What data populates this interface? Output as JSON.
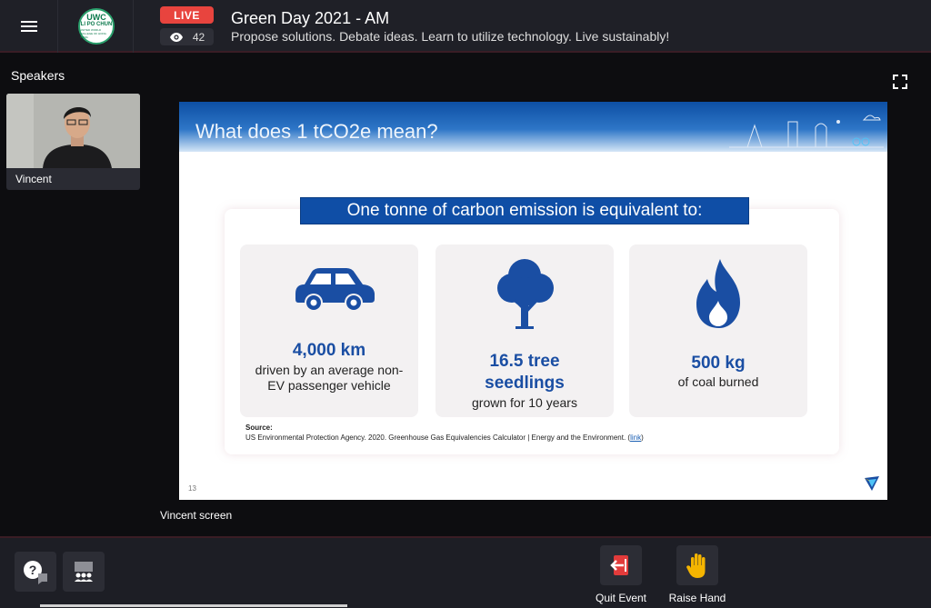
{
  "header": {
    "menu_icon": "hamburger-menu-icon",
    "logo": {
      "line1": "UWC",
      "line2": "LI PO CHUN",
      "line3": "UNITED WORLD COLLEGE OF HONG KONG"
    },
    "live_label": "LIVE",
    "viewer_icon": "eye-icon",
    "viewer_count": "42",
    "title": "Green Day 2021 - AM",
    "subtitle": "Propose solutions. Debate ideas. Learn to utilize technology. Live sustainably!"
  },
  "speakers": {
    "label": "Speakers",
    "items": [
      {
        "name": "Vincent"
      }
    ]
  },
  "stage": {
    "expand_icon": "fullscreen-icon",
    "screen_label": "Vincent screen"
  },
  "slide": {
    "title": "What does 1 tCO2e mean?",
    "banner": "One tonne of carbon emission is equivalent to:",
    "cards": [
      {
        "icon": "car-icon",
        "value": "4,000 km",
        "desc_line1": "driven by an average non-",
        "desc_line2": "EV passenger vehicle"
      },
      {
        "icon": "tree-icon",
        "value_line1": "16.5 tree",
        "value_line2": "seedlings",
        "desc_line1": "grown for 10 years"
      },
      {
        "icon": "flame-icon",
        "value": "500 kg",
        "desc_line1": "of coal burned"
      }
    ],
    "source_title": "Source:",
    "source_text": "US Environmental Protection Agency. 2020. Greenhouse Gas Equivalencies Calculator | Energy and the Environment. (",
    "source_link": "link",
    "source_end": ")",
    "page_number": "13"
  },
  "bottombar": {
    "qa_icon": "question-chat-icon",
    "people_icon": "audience-icon",
    "quit_label": "Quit Event",
    "raise_label": "Raise Hand",
    "colors": {
      "quit": "#e23b3b",
      "raise": "#f4b400"
    }
  }
}
